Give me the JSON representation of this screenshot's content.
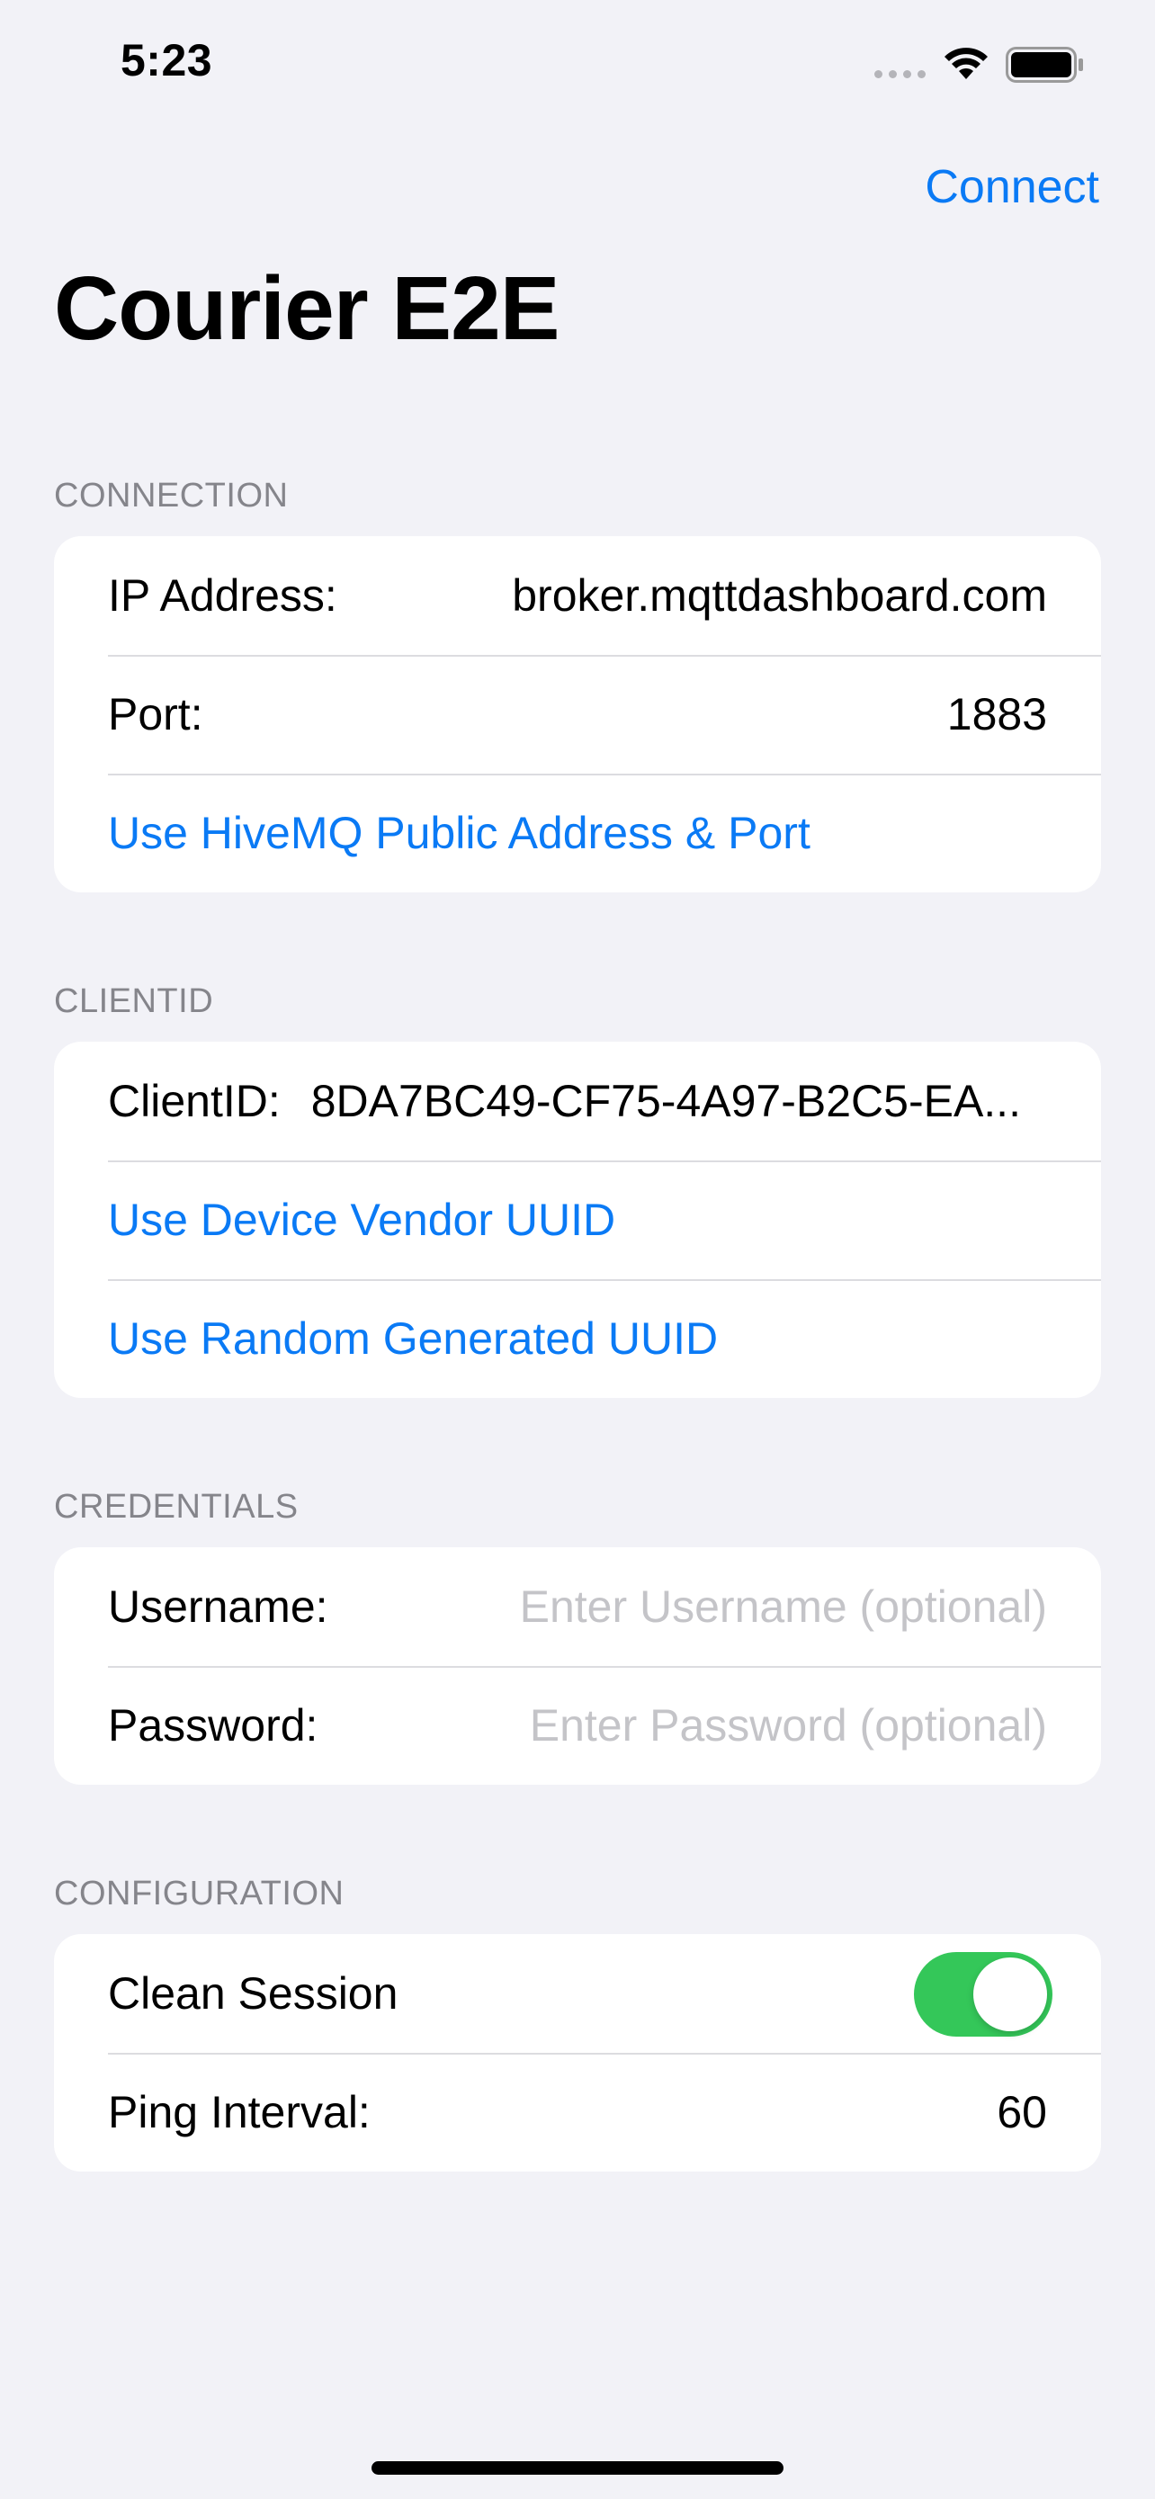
{
  "status_bar": {
    "time": "5:23",
    "icons": [
      "signal-dots-icon",
      "wifi-icon",
      "battery-icon"
    ]
  },
  "nav": {
    "connect_label": "Connect",
    "title": "Courier E2E"
  },
  "colors": {
    "background": "#f2f2f7",
    "accent": "#0a7af5",
    "toggle_on": "#34c759",
    "placeholder": "#c4c4c8",
    "section_header": "#85858b"
  },
  "connection": {
    "header": "CONNECTION",
    "ip_label": "IP Address:",
    "ip_value": "broker.mqttdashboard.com",
    "port_label": "Port:",
    "port_value": "1883",
    "use_hivemq": "Use HiveMQ Public Address & Port"
  },
  "clientid": {
    "header": "CLIENTID",
    "label": "ClientID:",
    "value": "8DA7BC49-CF75-4A97-B2C5-EA...",
    "use_vendor_uuid": "Use Device Vendor UUID",
    "use_random_uuid": "Use Random Generated UUID"
  },
  "credentials": {
    "header": "CREDENTIALS",
    "username_label": "Username:",
    "username_placeholder": "Enter Username (optional)",
    "username_value": "",
    "password_label": "Password:",
    "password_placeholder": "Enter Password (optional)",
    "password_value": ""
  },
  "configuration": {
    "header": "CONFIGURATION",
    "clean_session_label": "Clean Session",
    "clean_session_on": true,
    "ping_label": "Ping Interval:",
    "ping_value": "60"
  }
}
